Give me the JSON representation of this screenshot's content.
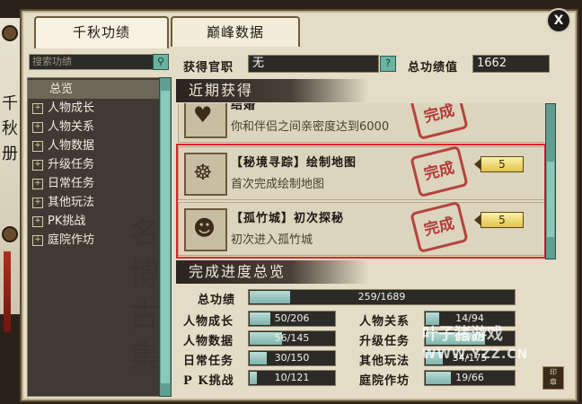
{
  "tabs": [
    {
      "label": "千秋功绩",
      "active": true
    },
    {
      "label": "巅峰数据",
      "active": false
    }
  ],
  "scroll_banner": "千秋册",
  "search": {
    "placeholder": "搜索功绩"
  },
  "tree": [
    {
      "label": "总览",
      "expandable": false,
      "selected": true
    },
    {
      "label": "人物成长",
      "expandable": true
    },
    {
      "label": "人物关系",
      "expandable": true
    },
    {
      "label": "人物数据",
      "expandable": true
    },
    {
      "label": "升级任务",
      "expandable": true
    },
    {
      "label": "日常任务",
      "expandable": true
    },
    {
      "label": "其他玩法",
      "expandable": true
    },
    {
      "label": "PK挑战",
      "expandable": true
    },
    {
      "label": "庭院作坊",
      "expandable": true
    }
  ],
  "header": {
    "title_label": "获得官职",
    "title_value": "无",
    "help": "?",
    "score_label": "总功绩值",
    "score_value": "1662"
  },
  "recent": {
    "heading": "近期获得",
    "items": [
      {
        "title": "结婚",
        "desc": "你和伴侣之间亲密度达到6000",
        "stamp": "完成",
        "points": ""
      },
      {
        "title": "【秘境寻踪】绘制地图",
        "desc": "首次完成绘制地图",
        "stamp": "完成",
        "points": "5"
      },
      {
        "title": "【孤竹城】初次探秘",
        "desc": "初次进入孤竹城",
        "stamp": "完成",
        "points": "5"
      }
    ]
  },
  "progress": {
    "heading": "完成进度总览",
    "total": {
      "label": "总功绩",
      "text": "259/1689",
      "fraction": 0.153
    },
    "rows": [
      {
        "label": "人物成长",
        "text": "50/206",
        "fraction": 0.243
      },
      {
        "label": "人物关系",
        "text": "14/94",
        "fraction": 0.149
      },
      {
        "label": "人物数据",
        "text": "56/145",
        "fraction": 0.386
      },
      {
        "label": "升级任务",
        "text": "63/93",
        "fraction": 0.677
      },
      {
        "label": "日常任务",
        "text": "30/150",
        "fraction": 0.2
      },
      {
        "label": "其他玩法",
        "text": "34/175",
        "fraction": 0.194
      },
      {
        "label": "P K挑战",
        "text": "10/121",
        "fraction": 0.083
      },
      {
        "label": "庭院作坊",
        "text": "19/66",
        "fraction": 0.288
      }
    ]
  },
  "watermark": {
    "line1": "叶子猪游戏",
    "line2": "WWW.YZZ.CN"
  },
  "close_glyph": "X"
}
